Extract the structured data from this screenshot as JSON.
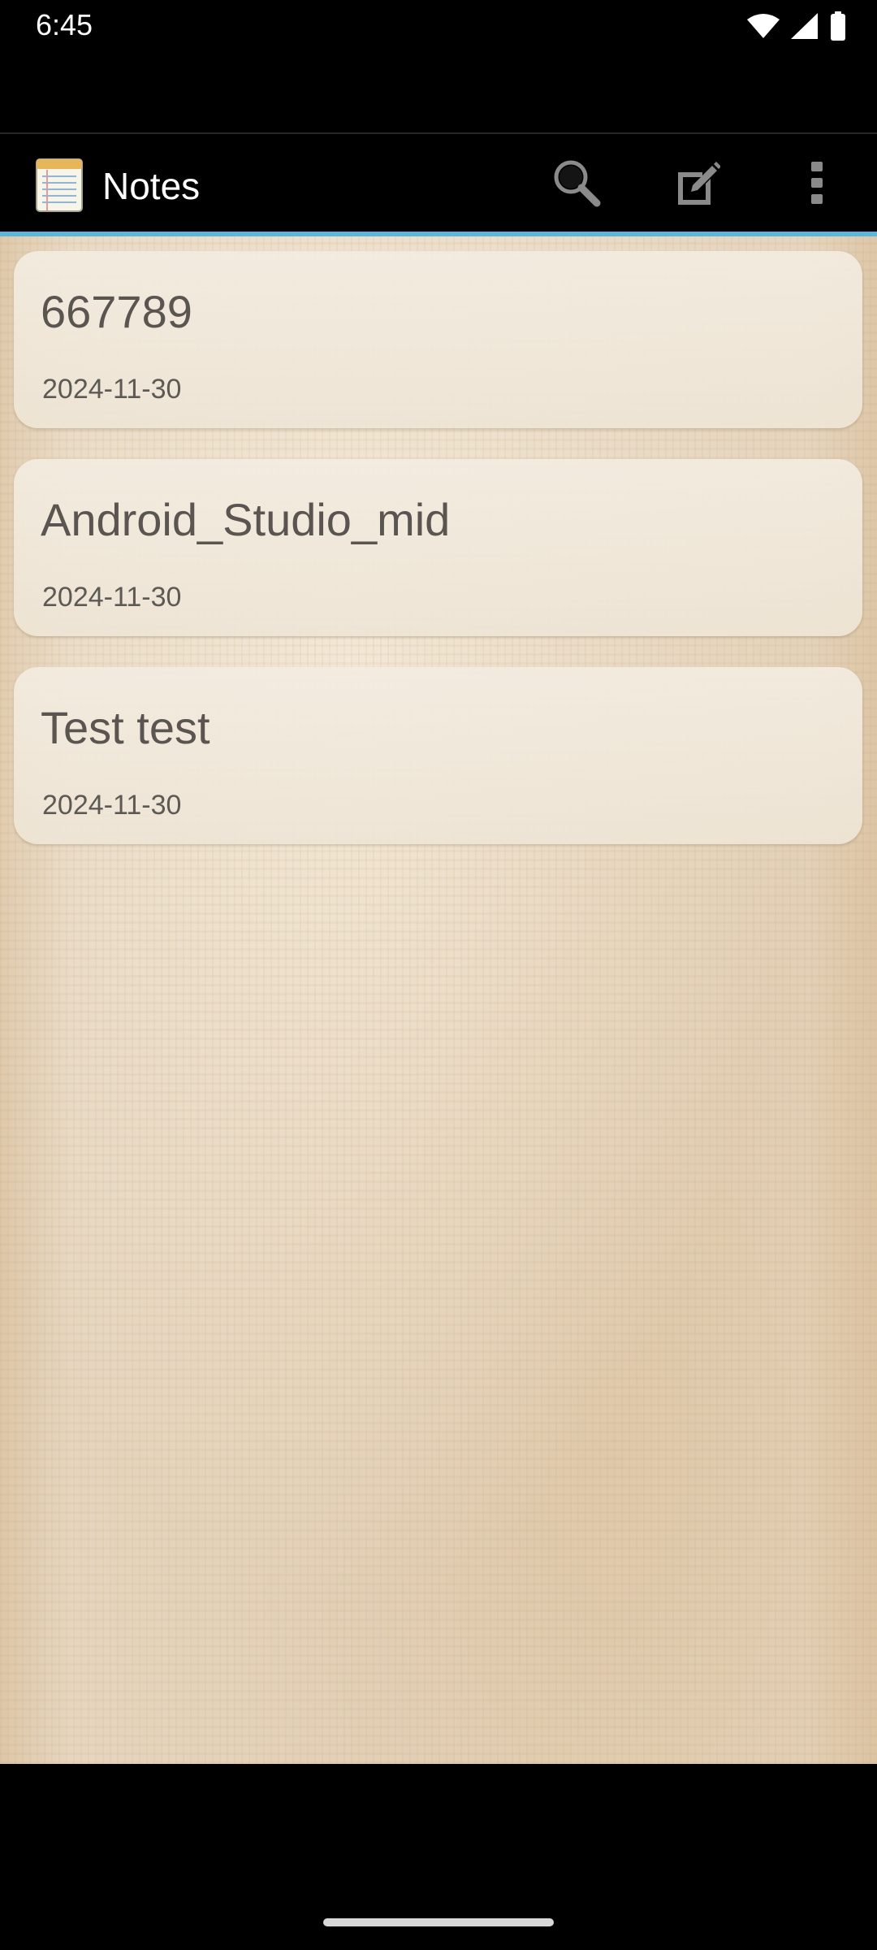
{
  "status_bar": {
    "time": "6:45",
    "icons": [
      "wifi-icon",
      "signal-icon",
      "battery-icon"
    ]
  },
  "action_bar": {
    "title": "Notes",
    "app_icon": "notepad-icon",
    "actions": [
      "search-icon",
      "new-note-icon",
      "more-vert-icon"
    ],
    "underline_color": "#5bb7dc"
  },
  "notes": [
    {
      "title": "667789",
      "date": "2024-11-30"
    },
    {
      "title": "Android_Studio_mid",
      "date": "2024-11-30"
    },
    {
      "title": "Test test",
      "date": "2024-11-30"
    }
  ],
  "colors": {
    "background": "#e6d6bf",
    "card": "#f1e9dc",
    "text": "#5a5550",
    "accent": "#5bb7dc"
  }
}
